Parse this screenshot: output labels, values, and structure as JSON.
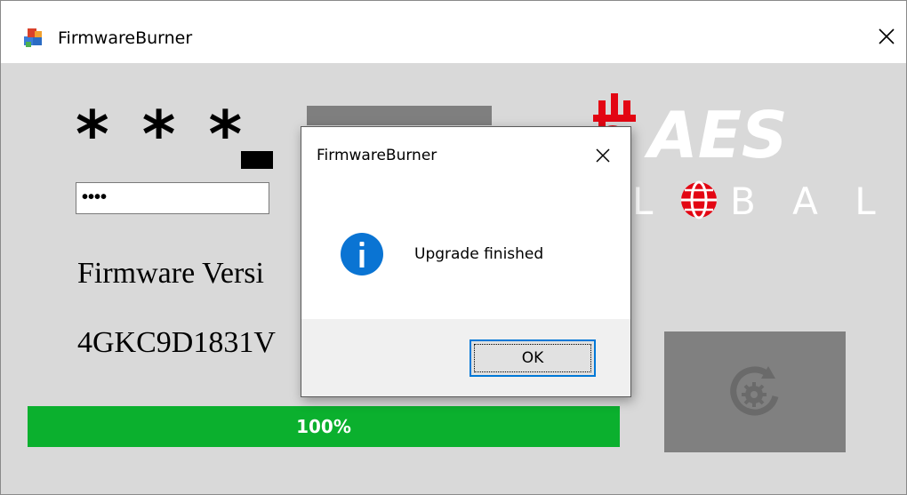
{
  "window": {
    "title": "FirmwareBurner",
    "icon": "app-blocks-icon",
    "close_icon": "close-icon"
  },
  "form": {
    "masked_label": "***_",
    "password_value": "••••",
    "firmware_label": "Firmware Versi",
    "firmware_value": "4GKC9D1831V"
  },
  "progress": {
    "value": 1.0,
    "label": "100%",
    "color": "#0bb02e"
  },
  "logo": {
    "text_top": "AES",
    "text_bottom_l": "L",
    "text_bottom_rest": "B A L",
    "accent": "#e30613"
  },
  "refresh_button": {
    "icon": "refresh-gear-icon"
  },
  "dialog": {
    "title": "FirmwareBurner",
    "message": "Upgrade finished",
    "icon": "info-icon",
    "ok_label": "OK",
    "accent": "#0078d7"
  }
}
